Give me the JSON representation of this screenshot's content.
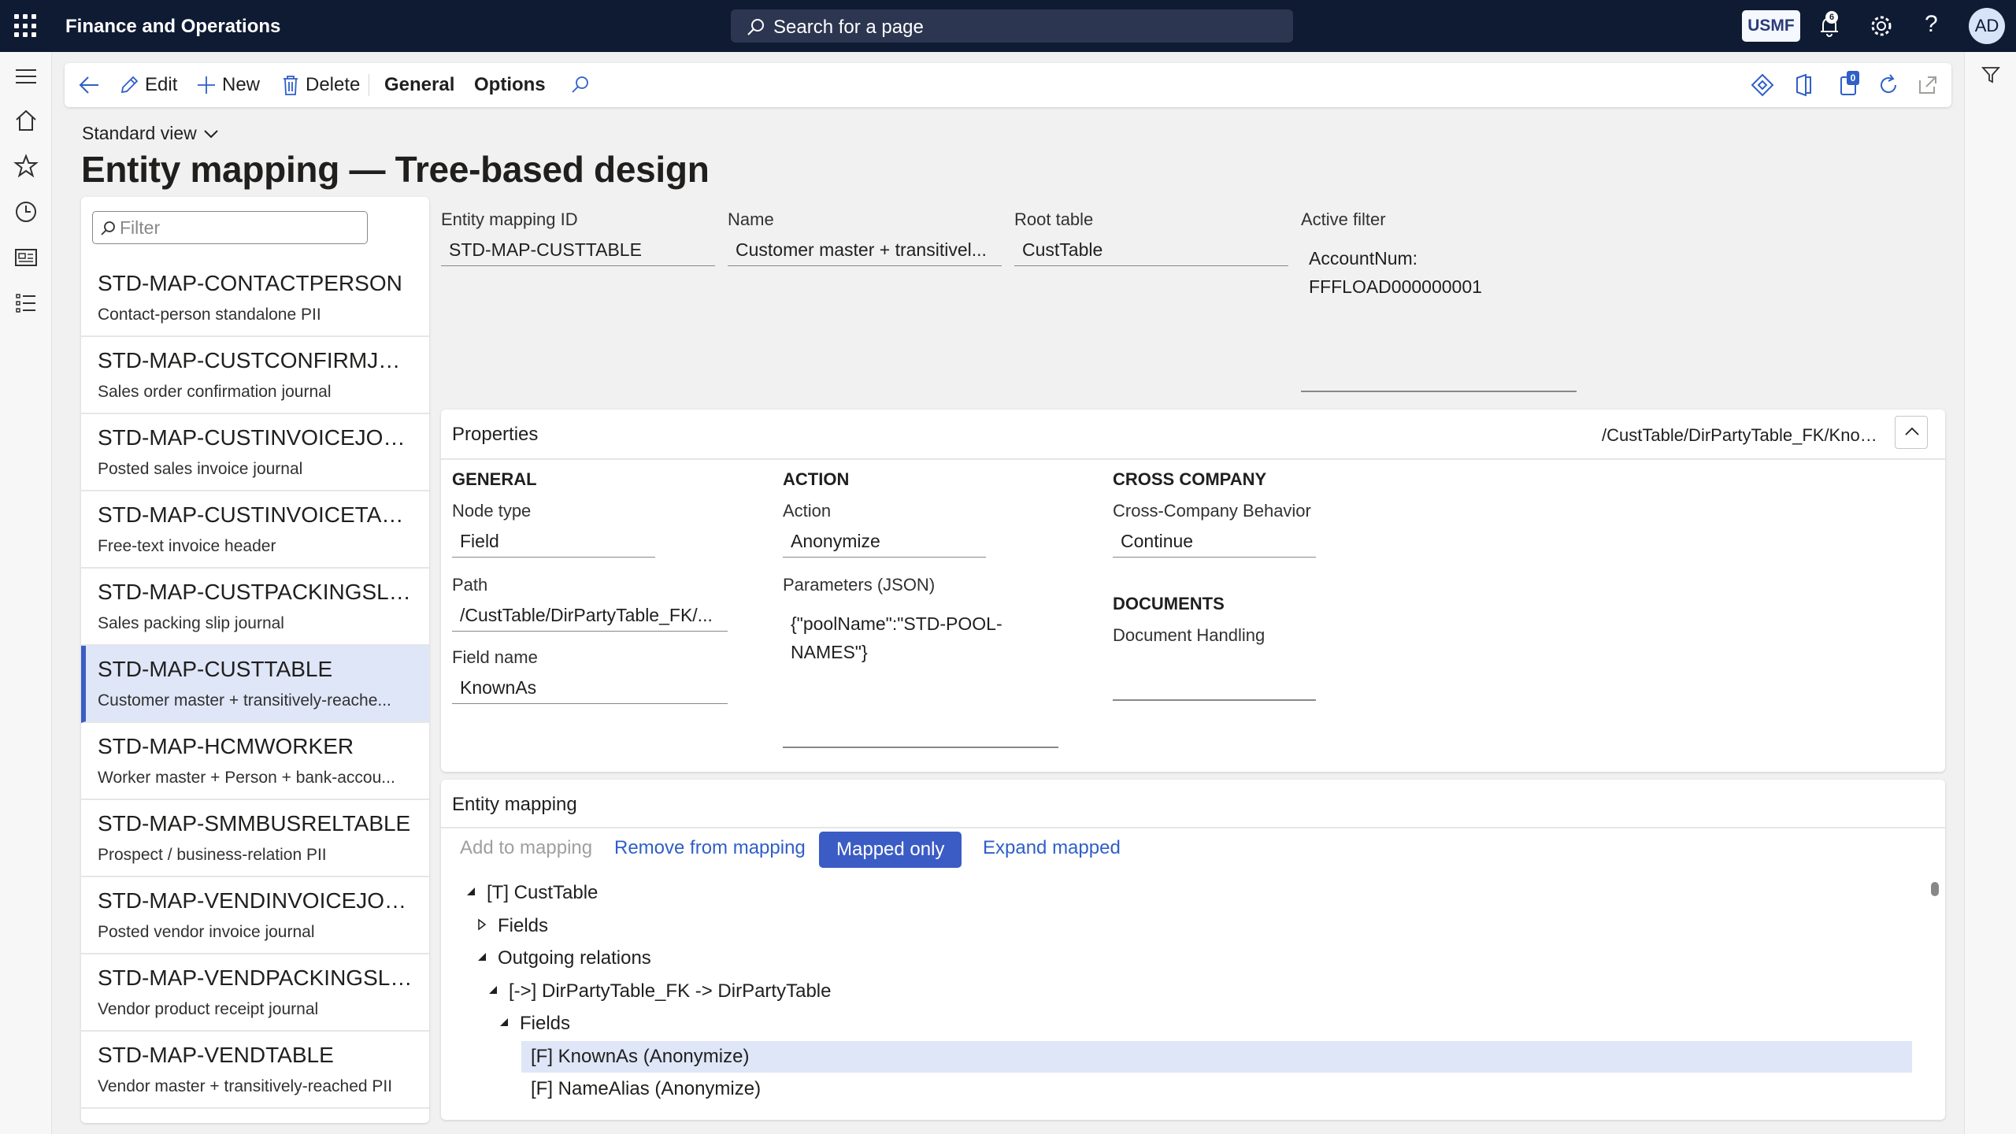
{
  "topbar": {
    "app_title": "Finance and Operations",
    "search_placeholder": "Search for a page",
    "company": "USMF",
    "notification_count": "6",
    "help_glyph": "?",
    "avatar_initials": "AD"
  },
  "leftnav": {
    "icons": [
      "hamburger-icon",
      "home-icon",
      "star-icon",
      "clock-icon",
      "workspace-icon",
      "list-icon"
    ]
  },
  "actionbar": {
    "back_icon": "back-arrow-icon",
    "edit_label": "Edit",
    "new_label": "New",
    "delete_label": "Delete",
    "general_label": "General",
    "options_label": "Options",
    "search_icon": "search-icon",
    "right_icons": [
      "diamond-icon",
      "office-icon",
      "attachments-icon",
      "refresh-icon",
      "popout-icon"
    ],
    "attachments_count": "0"
  },
  "view": {
    "selector_label": "Standard view",
    "page_title": "Entity mapping — Tree-based design"
  },
  "list": {
    "filter_placeholder": "Filter",
    "items": [
      {
        "title": "STD-MAP-CONTACTPERSON",
        "subtitle": "Contact-person standalone PII"
      },
      {
        "title": "STD-MAP-CUSTCONFIRMJOUR",
        "subtitle": "Sales order confirmation journal"
      },
      {
        "title": "STD-MAP-CUSTINVOICEJOUR",
        "subtitle": "Posted sales invoice journal"
      },
      {
        "title": "STD-MAP-CUSTINVOICETABLE",
        "subtitle": "Free-text invoice header"
      },
      {
        "title": "STD-MAP-CUSTPACKINGSLIP...",
        "subtitle": "Sales packing slip journal"
      },
      {
        "title": "STD-MAP-CUSTTABLE",
        "subtitle": "Customer master + transitively-reache..."
      },
      {
        "title": "STD-MAP-HCMWORKER",
        "subtitle": "Worker master + Person + bank-accou..."
      },
      {
        "title": "STD-MAP-SMMBUSRELTABLE",
        "subtitle": "Prospect / business-relation PII"
      },
      {
        "title": "STD-MAP-VENDINVOICEJOUR",
        "subtitle": "Posted vendor invoice journal"
      },
      {
        "title": "STD-MAP-VENDPACKINGSLI...",
        "subtitle": "Vendor product receipt journal"
      },
      {
        "title": "STD-MAP-VENDTABLE",
        "subtitle": "Vendor master + transitively-reached PII"
      }
    ],
    "selected_index": 5
  },
  "header_fields": {
    "entity_mapping_id": {
      "label": "Entity mapping ID",
      "value": "STD-MAP-CUSTTABLE"
    },
    "name": {
      "label": "Name",
      "value": "Customer master + transitivel..."
    },
    "root_table": {
      "label": "Root table",
      "value": "CustTable"
    },
    "active_filter": {
      "label": "Active filter",
      "line1": "AccountNum:",
      "line2": "FFFLOAD000000001"
    }
  },
  "properties": {
    "title": "Properties",
    "path_display": "/CustTable/DirPartyTable_FK/Know...",
    "general": {
      "heading": "GENERAL",
      "node_type_label": "Node type",
      "node_type_value": "Field",
      "path_label": "Path",
      "path_value": "/CustTable/DirPartyTable_FK/...",
      "field_name_label": "Field name",
      "field_name_value": "KnownAs"
    },
    "action": {
      "heading": "ACTION",
      "action_label": "Action",
      "action_value": "Anonymize",
      "params_label": "Parameters (JSON)",
      "params_line1": "{\"poolName\":\"STD-POOL-",
      "params_line2": "NAMES\"}"
    },
    "cross_company": {
      "heading": "CROSS COMPANY",
      "behavior_label": "Cross-Company Behavior",
      "behavior_value": "Continue"
    },
    "documents": {
      "heading": "DOCUMENTS",
      "handling_label": "Document Handling"
    }
  },
  "entity_mapping": {
    "title": "Entity mapping",
    "add_label": "Add to mapping",
    "remove_label": "Remove from mapping",
    "mapped_only_label": "Mapped only",
    "expand_label": "Expand mapped",
    "tree": [
      {
        "text": "[T] CustTable",
        "level": 0,
        "state": "expanded"
      },
      {
        "text": "Fields",
        "level": 1,
        "state": "collapsed"
      },
      {
        "text": "Outgoing relations",
        "level": 1,
        "state": "expanded"
      },
      {
        "text": "[->] DirPartyTable_FK -> DirPartyTable",
        "level": 2,
        "state": "expanded"
      },
      {
        "text": "Fields",
        "level": 3,
        "state": "expanded"
      },
      {
        "text": "[F] KnownAs (Anonymize)",
        "level": 4,
        "state": "leaf",
        "selected": true
      },
      {
        "text": "[F] NameAlias (Anonymize)",
        "level": 4,
        "state": "leaf"
      }
    ]
  },
  "colors": {
    "topbar_bg": "#0f1a33",
    "accent": "#3b5cc4",
    "selection_bg": "#dfe6f8",
    "link": "#2f5fc7"
  }
}
